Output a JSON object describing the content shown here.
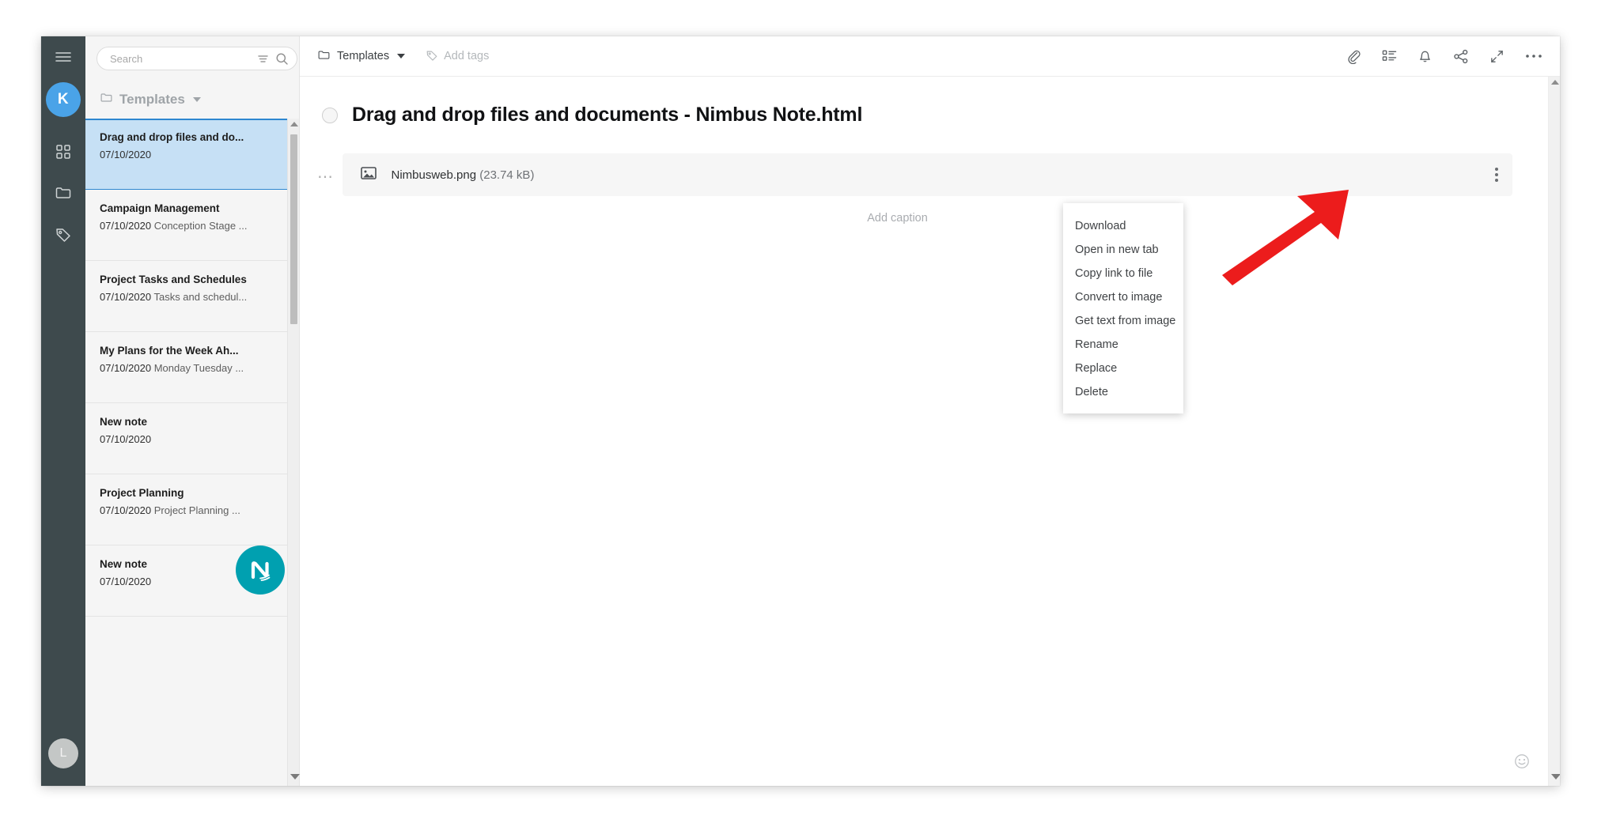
{
  "rail": {
    "menu_icon": "hamburger-icon",
    "account_initial": "K",
    "items": [
      {
        "icon": "apps-grid-icon",
        "name": "workspaces"
      },
      {
        "icon": "folder-icon",
        "name": "folders"
      },
      {
        "icon": "tag-icon",
        "name": "tags"
      }
    ],
    "bottom_avatar_initial": "L"
  },
  "list_panel": {
    "search": {
      "placeholder": "Search",
      "value": "",
      "filter_icon": "filter-icon",
      "search_icon": "search-icon"
    },
    "add_button_label": "+",
    "folder": {
      "icon": "folder-icon",
      "name": "Templates",
      "caret": "chevron-down-icon"
    },
    "notes": [
      {
        "title": "Drag and drop files and do...",
        "date": "07/10/2020",
        "preview": "",
        "selected": true,
        "badge": ""
      },
      {
        "title": "Campaign Management",
        "date": "07/10/2020",
        "preview": "Conception Stage ...",
        "selected": false,
        "badge": ""
      },
      {
        "title": "Project Tasks and Schedules",
        "date": "07/10/2020",
        "preview": "Tasks and schedul...",
        "selected": false,
        "badge": ""
      },
      {
        "title": "My Plans for the Week Ah...",
        "date": "07/10/2020",
        "preview": "Monday Tuesday ...",
        "selected": false,
        "badge": ""
      },
      {
        "title": "New note",
        "date": "07/10/2020",
        "preview": "",
        "selected": false,
        "badge": ""
      },
      {
        "title": "Project Planning",
        "date": "07/10/2020",
        "preview": "Project Planning ...",
        "selected": false,
        "badge": ""
      },
      {
        "title": "New note",
        "date": "07/10/2020",
        "preview": "",
        "selected": false,
        "badge": "nimbus-logo"
      }
    ]
  },
  "editor": {
    "breadcrumb": {
      "folder_icon": "folder-icon",
      "folder": "Templates",
      "caret": "chevron-down-icon"
    },
    "add_tags": {
      "icon": "tag-icon",
      "label": "Add tags"
    },
    "toolbar_icons": [
      {
        "name": "attachment-icon"
      },
      {
        "name": "outline-list-icon"
      },
      {
        "name": "bell-icon"
      },
      {
        "name": "share-icon"
      },
      {
        "name": "expand-icon"
      },
      {
        "name": "more-horizontal-icon"
      }
    ],
    "title": "Drag and drop files and documents - Nimbus Note.html",
    "attachment": {
      "icon": "image-file-icon",
      "name": "Nimbusweb.png",
      "size": "(23.74 kB)",
      "kebab": "more-vertical-icon"
    },
    "caption_placeholder": "Add caption",
    "emoji_button": "smiley-icon"
  },
  "context_menu": {
    "items": [
      "Download",
      "Open in new tab",
      "Copy link to file",
      "Convert to image",
      "Get text from image",
      "Rename",
      "Replace",
      "Delete"
    ]
  },
  "annotation": {
    "arrow_color": "#ec1c1c",
    "points_to": "Download"
  },
  "colors": {
    "rail": "#3e4a4d",
    "accent": "#00a0b0",
    "avatar": "#4aa3e8",
    "selection": "#c6e0f5",
    "selection_border": "#2e87d0"
  }
}
